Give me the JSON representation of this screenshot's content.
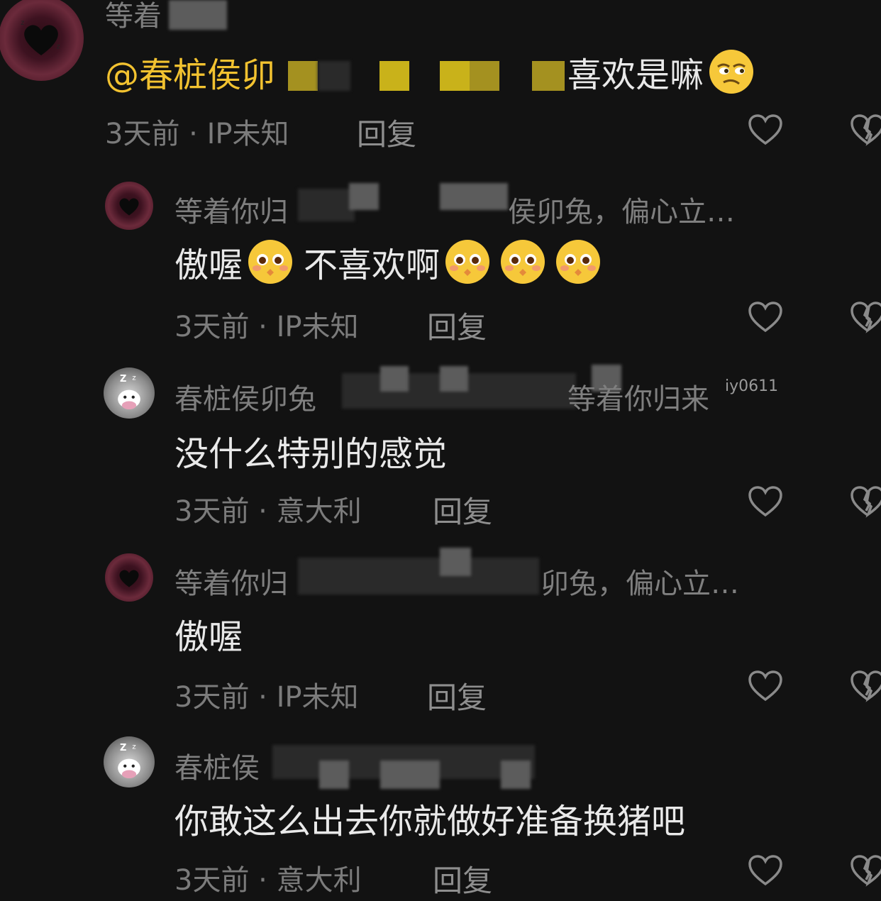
{
  "comments": [
    {
      "username": "等着",
      "text_mention": "@春桩侯卯",
      "text": "喜欢是嘛",
      "emoji": "smirking-face",
      "meta": "3天前 · IP未知",
      "reply": "回复"
    },
    {
      "username_start": "等着你归",
      "username_end": "侯卯兔，偏心立…",
      "text_a": "傲喔",
      "text_b": "不喜欢啊",
      "emoji": "pleading-face",
      "meta": "3天前 · IP未知",
      "reply": "回复"
    },
    {
      "username_start": "春桩侯卯兔",
      "username_end": "等着你归来",
      "username_tag": "iy0611",
      "text": "没什么特别的感觉",
      "meta": "3天前 · 意大利",
      "reply": "回复"
    },
    {
      "username_start": "等着你归",
      "username_end": "卯兔，偏心立…",
      "text": "傲喔",
      "meta": "3天前 · IP未知",
      "reply": "回复"
    },
    {
      "username_start": "春桩侯",
      "text": "你敢这么出去你就做好准备换猪吧",
      "meta": "3天前 · 意大利",
      "reply": "回复"
    }
  ],
  "icons": {
    "like": "heart-outline-icon",
    "dislike": "broken-heart-icon"
  },
  "colors": {
    "background": "#121212",
    "mention": "#f2c230",
    "text": "#e9e9e9",
    "muted": "#7b7b7b"
  }
}
